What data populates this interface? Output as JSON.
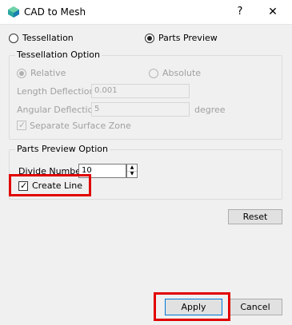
{
  "window": {
    "title": "CAD to Mesh",
    "help": "?",
    "close": "✕"
  },
  "mode": {
    "tessellation_label": "Tessellation",
    "parts_preview_label": "Parts Preview",
    "selected": "Parts Preview"
  },
  "tessellation_option": {
    "title": "Tessellation Option",
    "relative_label": "Relative",
    "absolute_label": "Absolute",
    "length_deflection_label": "Length Deflection",
    "length_deflection_value": "0.001",
    "angular_deflection_label": "Angular Deflection",
    "angular_deflection_value": "5",
    "angular_unit": "degree",
    "separate_surface_zone_label": "Separate Surface Zone",
    "separate_surface_zone_checked": true
  },
  "parts_preview_option": {
    "title": "Parts Preview Option",
    "divide_number_label": "Divide Number",
    "divide_number_value": "10",
    "create_line_label": "Create Line",
    "create_line_checked": true
  },
  "buttons": {
    "reset": "Reset",
    "apply": "Apply",
    "cancel": "Cancel"
  },
  "colors": {
    "highlight": "#e10000",
    "default_button_border": "#0078d7"
  }
}
